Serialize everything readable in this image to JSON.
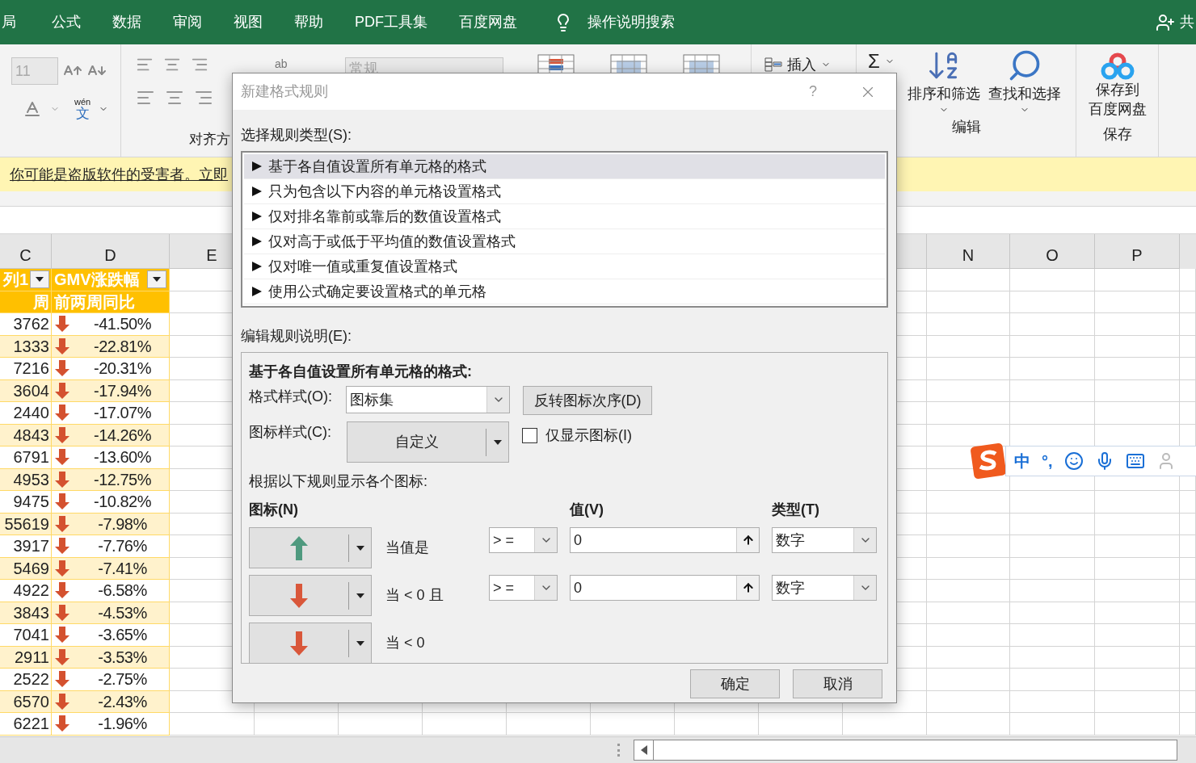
{
  "ribbon_tabs": [
    "局",
    "公式",
    "数据",
    "审阅",
    "视图",
    "帮助",
    "PDF工具集",
    "百度网盘"
  ],
  "tell_me": "操作说明搜索",
  "share": "共",
  "ribbon": {
    "font_size": "11",
    "phonetic_ruby": "wén",
    "phonetic_char": "文",
    "wrap_label": "ab",
    "alignment_group": "对齐方",
    "number_format": "常规",
    "insert": "插入",
    "sum": "Σ",
    "sort_filter": "排序和筛选",
    "find_select": "查找和选择",
    "editing_group": "编辑",
    "save_lines": [
      "保存到",
      "百度网盘"
    ],
    "save_group": "保存"
  },
  "warning_bar": {
    "text": "你可能是盗版软件的受害者。立即"
  },
  "sheet": {
    "columns": [
      "C",
      "D",
      "E",
      "N",
      "O",
      "P"
    ],
    "header_rows": [
      [
        "列1",
        "GMV涨跌幅"
      ],
      [
        "周",
        "前两周同比"
      ]
    ],
    "rows": [
      {
        "c": "3762",
        "d": "-41.50%"
      },
      {
        "c": "1333",
        "d": "-22.81%"
      },
      {
        "c": "7216",
        "d": "-20.31%"
      },
      {
        "c": "3604",
        "d": "-17.94%"
      },
      {
        "c": "2440",
        "d": "-17.07%"
      },
      {
        "c": "4843",
        "d": "-14.26%"
      },
      {
        "c": "6791",
        "d": "-13.60%"
      },
      {
        "c": "4953",
        "d": "-12.75%"
      },
      {
        "c": "9475",
        "d": "-10.82%"
      },
      {
        "c": "55619",
        "d": "-7.98%"
      },
      {
        "c": "3917",
        "d": "-7.76%"
      },
      {
        "c": "5469",
        "d": "-7.41%"
      },
      {
        "c": "4922",
        "d": "-6.58%"
      },
      {
        "c": "3843",
        "d": "-4.53%"
      },
      {
        "c": "7041",
        "d": "-3.65%"
      },
      {
        "c": "2911",
        "d": "-3.53%"
      },
      {
        "c": "2522",
        "d": "-2.75%"
      },
      {
        "c": "6570",
        "d": "-2.43%"
      },
      {
        "c": "6221",
        "d": "-1.96%"
      }
    ]
  },
  "dialog": {
    "title": "新建格式规则",
    "help": "?",
    "rule_type_label": "选择规则类型(S):",
    "rule_types": [
      {
        "label": "基于各自值设置所有单元格的格式",
        "selected": true
      },
      {
        "label": "只为包含以下内容的单元格设置格式",
        "selected": false
      },
      {
        "label": "仅对排名靠前或靠后的数值设置格式",
        "selected": false
      },
      {
        "label": "仅对高于或低于平均值的数值设置格式",
        "selected": false
      },
      {
        "label": "仅对唯一值或重复值设置格式",
        "selected": false
      },
      {
        "label": "使用公式确定要设置格式的单元格",
        "selected": false
      }
    ],
    "edit_label": "编辑规则说明(E):",
    "panel_title": "基于各自值设置所有单元格的格式:",
    "format_style_label": "格式样式(O):",
    "format_style": "图标集",
    "reverse_button": "反转图标次序(D)",
    "icon_style_label": "图标样式(C):",
    "icon_style": "自定义",
    "icons_only": {
      "label": "仅显示图标(I)",
      "checked": false
    },
    "rules_label": "根据以下规则显示各个图标:",
    "headers": [
      "图标(N)",
      "值(V)",
      "类型(T)"
    ],
    "rules": [
      {
        "kind": "up",
        "condition": "当值是",
        "operator": "> =",
        "value": "0",
        "type": "数字"
      },
      {
        "kind": "down",
        "condition": "当 < 0 且",
        "operator": "> =",
        "value": "0",
        "type": "数字"
      },
      {
        "kind": "down",
        "condition": "当 < 0"
      }
    ],
    "buttons": [
      "确定",
      "取消"
    ]
  },
  "ime": {
    "mode": "中",
    "punct": "°,"
  }
}
